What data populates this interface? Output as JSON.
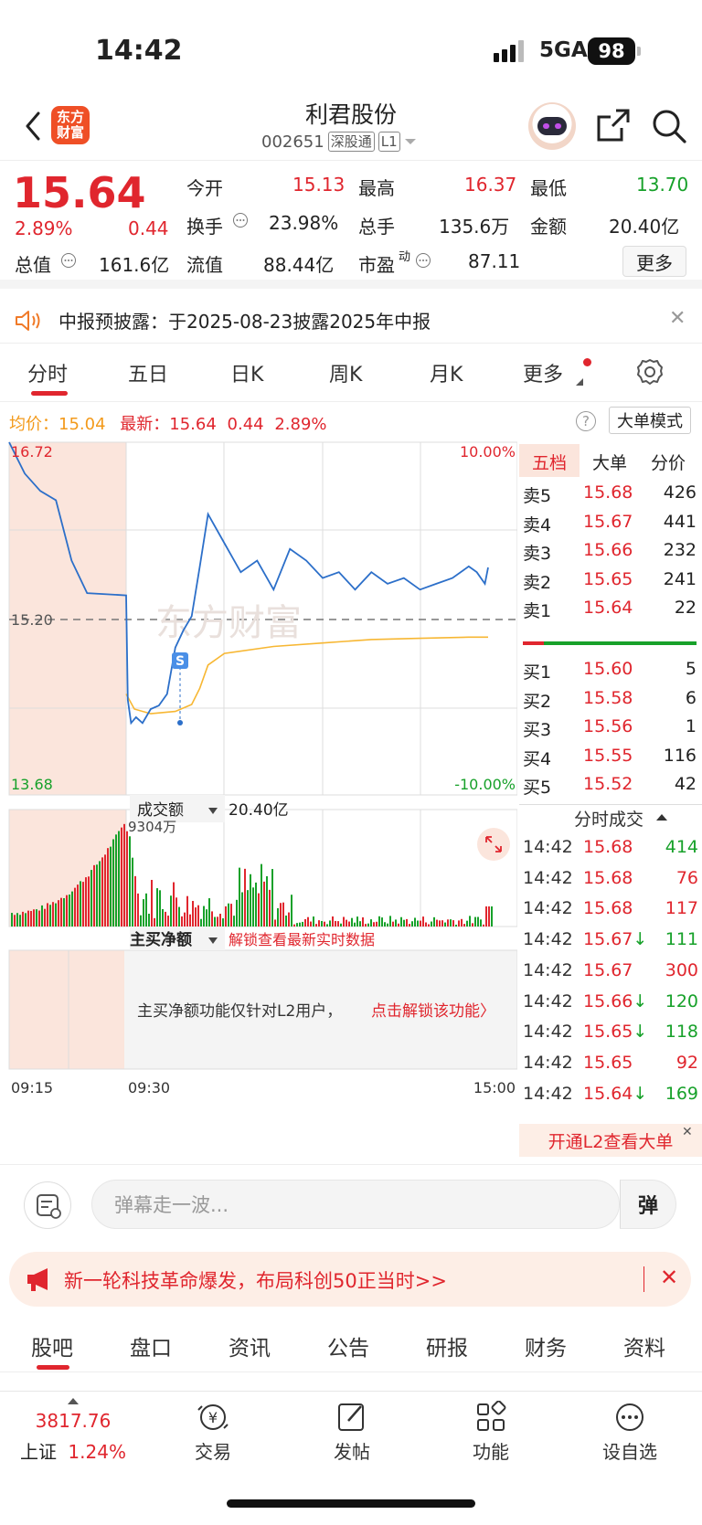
{
  "status": {
    "time": "14:42",
    "network": "5GA",
    "battery": "98"
  },
  "header": {
    "logo": [
      "东方",
      "财富"
    ],
    "name": "利君股份",
    "code": "002651",
    "market_tag": "深股通",
    "level_tag": "L1"
  },
  "quote": {
    "price": "15.64",
    "change_pct": "2.89%",
    "change": "0.44",
    "open_label": "今开",
    "open": "15.13",
    "high_label": "最高",
    "high": "16.37",
    "low_label": "最低",
    "low": "13.70",
    "turnover_label": "换手",
    "turnover": "23.98%",
    "volume_label": "总手",
    "volume": "135.6万",
    "amount_label": "金额",
    "amount": "20.40亿",
    "mktcap_label": "总值",
    "mktcap": "161.6亿",
    "float_label": "流值",
    "float": "88.44亿",
    "pe_label": "市盈",
    "pe_sup": "动",
    "pe": "87.11",
    "more": "更多"
  },
  "notice": {
    "text": "中报预披露：于2025-08-23披露2025年中报"
  },
  "tabs": [
    "分时",
    "五日",
    "日K",
    "周K",
    "月K",
    "更多"
  ],
  "intraday": {
    "avg_label": "均价：",
    "avg": "15.04",
    "last_label": "最新：",
    "last": "15.64",
    "last_change": "0.44",
    "last_pct": "2.89%",
    "help": "?",
    "big_order_mode": "大单模式",
    "y_top": "16.72",
    "y_mid": "15.20",
    "y_bottom": "13.68",
    "pct_top": "10.00%",
    "pct_bottom": "-10.00%",
    "watermark": "东方财富",
    "marker": "S",
    "volume_selector": "成交额",
    "volume_total": "20.40亿",
    "volume_max": "9304万",
    "netbuy_selector": "主买净额",
    "netbuy_unlock": "解锁查看最新实时数据",
    "netbuy_msg": "主买净额功能仅针对L2用户，",
    "netbuy_link": "点击解锁该功能〉",
    "time_start": "09:15",
    "time_open": "09:30",
    "time_end": "15:00"
  },
  "chart_data": {
    "type": "line",
    "title": "",
    "y_range": [
      13.68,
      16.72
    ],
    "pre_close": 15.2,
    "series": [
      {
        "name": "最新",
        "x": [
          "09:15",
          "09:17",
          "09:19",
          "09:21",
          "09:23",
          "09:25",
          "09:30",
          "09:31",
          "09:33",
          "09:36",
          "09:40",
          "09:45",
          "09:50",
          "09:55",
          "10:00",
          "10:05",
          "10:10",
          "10:15",
          "10:20",
          "10:30",
          "10:40",
          "10:50",
          "11:00",
          "11:10",
          "11:20",
          "11:30",
          "13:10",
          "13:20",
          "13:30",
          "13:40",
          "13:50",
          "14:00",
          "14:10",
          "14:20",
          "14:30",
          "14:35",
          "14:40",
          "14:42"
        ],
        "values": [
          16.72,
          16.45,
          16.3,
          16.22,
          15.7,
          15.42,
          15.4,
          14.5,
          14.3,
          14.35,
          14.3,
          14.42,
          14.45,
          14.55,
          14.95,
          15.1,
          15.22,
          15.65,
          16.1,
          15.85,
          15.6,
          15.7,
          15.45,
          15.8,
          15.7,
          15.55,
          15.6,
          15.45,
          15.6,
          15.5,
          15.55,
          15.45,
          15.5,
          15.55,
          15.65,
          15.6,
          15.5,
          15.64
        ]
      },
      {
        "name": "均价",
        "x": [
          "09:30",
          "09:35",
          "09:45",
          "10:00",
          "10:10",
          "10:15",
          "10:20",
          "10:30",
          "11:00",
          "11:30",
          "13:30",
          "14:00",
          "14:30",
          "14:42"
        ],
        "values": [
          14.55,
          14.42,
          14.38,
          14.4,
          14.46,
          14.6,
          14.8,
          14.9,
          14.96,
          14.99,
          15.02,
          15.03,
          15.04,
          15.04
        ]
      }
    ]
  },
  "orderbook": {
    "tabs": [
      "五档",
      "大单",
      "分价"
    ],
    "asks": [
      {
        "label": "卖5",
        "price": "15.68",
        "vol": "426"
      },
      {
        "label": "卖4",
        "price": "15.67",
        "vol": "441"
      },
      {
        "label": "卖3",
        "price": "15.66",
        "vol": "232"
      },
      {
        "label": "卖2",
        "price": "15.65",
        "vol": "241"
      },
      {
        "label": "卖1",
        "price": "15.64",
        "vol": "22"
      }
    ],
    "bids": [
      {
        "label": "买1",
        "price": "15.60",
        "vol": "5"
      },
      {
        "label": "买2",
        "price": "15.58",
        "vol": "6"
      },
      {
        "label": "买3",
        "price": "15.56",
        "vol": "1"
      },
      {
        "label": "买4",
        "price": "15.55",
        "vol": "116"
      },
      {
        "label": "买5",
        "price": "15.52",
        "vol": "42"
      }
    ],
    "ticks_title": "分时成交",
    "ticks": [
      {
        "time": "14:42",
        "price": "15.68",
        "vol": "414",
        "dir": "buy"
      },
      {
        "time": "14:42",
        "price": "15.68",
        "vol": "76",
        "dir": "sell"
      },
      {
        "time": "14:42",
        "price": "15.68",
        "vol": "117",
        "dir": "sell"
      },
      {
        "time": "14:42",
        "price": "15.67↓",
        "vol": "111",
        "dir": "buy"
      },
      {
        "time": "14:42",
        "price": "15.67",
        "vol": "300",
        "dir": "sell"
      },
      {
        "time": "14:42",
        "price": "15.66↓",
        "vol": "120",
        "dir": "buy"
      },
      {
        "time": "14:42",
        "price": "15.65↓",
        "vol": "118",
        "dir": "buy"
      },
      {
        "time": "14:42",
        "price": "15.65",
        "vol": "92",
        "dir": "sell"
      },
      {
        "time": "14:42",
        "price": "15.64↓",
        "vol": "169",
        "dir": "buy"
      }
    ],
    "l2_banner": "开通L2查看大单"
  },
  "comment": {
    "placeholder": "弹幕走一波...",
    "danmu_btn": "弹"
  },
  "promo": {
    "text": "新一轮科技革命爆发，布局科创50正当时>>"
  },
  "bottom_tabs": [
    "股吧",
    "盘口",
    "资讯",
    "公告",
    "研报",
    "财务",
    "资料"
  ],
  "nav": {
    "index_value": "3817.76",
    "index_name": "上证",
    "index_pct": "1.24%",
    "items": [
      "交易",
      "发帖",
      "功能",
      "设自选"
    ]
  },
  "colors": {
    "up": "#e0262e",
    "down": "#17a12a",
    "avg_line": "#f7b733",
    "price_line": "#2c6fc9",
    "auction_bg": "#fbe5dc"
  }
}
